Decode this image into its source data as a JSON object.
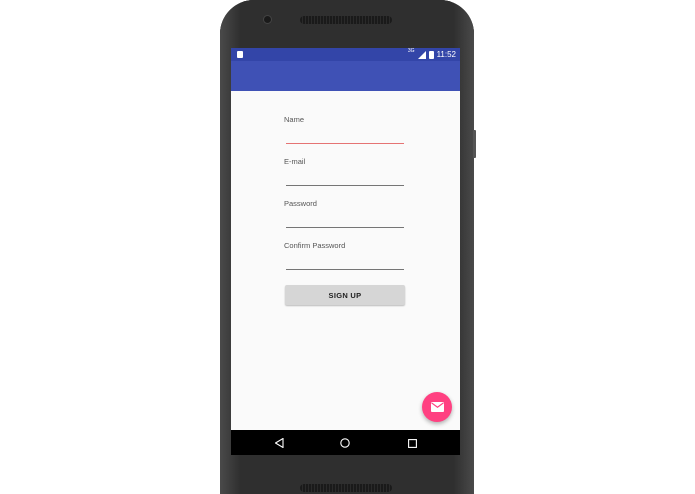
{
  "status_bar": {
    "time": "11:52",
    "signal_label": "3G"
  },
  "form": {
    "fields": [
      {
        "label": "Name",
        "active": true
      },
      {
        "label": "E-mail",
        "active": false
      },
      {
        "label": "Password",
        "active": false
      },
      {
        "label": "Confirm Password",
        "active": false
      }
    ],
    "signup_label": "SIGN UP"
  },
  "fab": {
    "icon": "mail-icon"
  },
  "nav": {
    "back": "back-icon",
    "home": "home-icon",
    "recents": "recents-icon"
  },
  "colors": {
    "primary": "#3f51b5",
    "primary_dark": "#3345a8",
    "accent": "#ff4081",
    "active_underline": "#e57373"
  }
}
